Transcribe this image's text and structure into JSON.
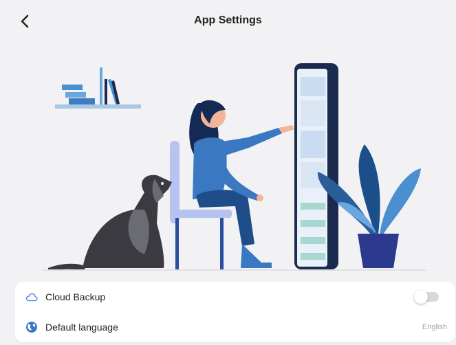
{
  "header": {
    "title": "App Settings",
    "back_icon": "chevron-left-icon"
  },
  "illustration": {
    "description_icon": "person-with-dog-and-phone-illustration"
  },
  "settings": [
    {
      "label": "Cloud Backup",
      "icon": "cloud-icon",
      "control": "toggle",
      "enabled": false
    },
    {
      "label": "Default language",
      "icon": "globe-icon",
      "value": "English"
    }
  ],
  "colors": {
    "background": "#f2f2f4",
    "card": "#ffffff",
    "accent_blue": "#4a90d9",
    "dark_navy": "#1b2b4d",
    "toggle_off": "#d9d9dd"
  }
}
